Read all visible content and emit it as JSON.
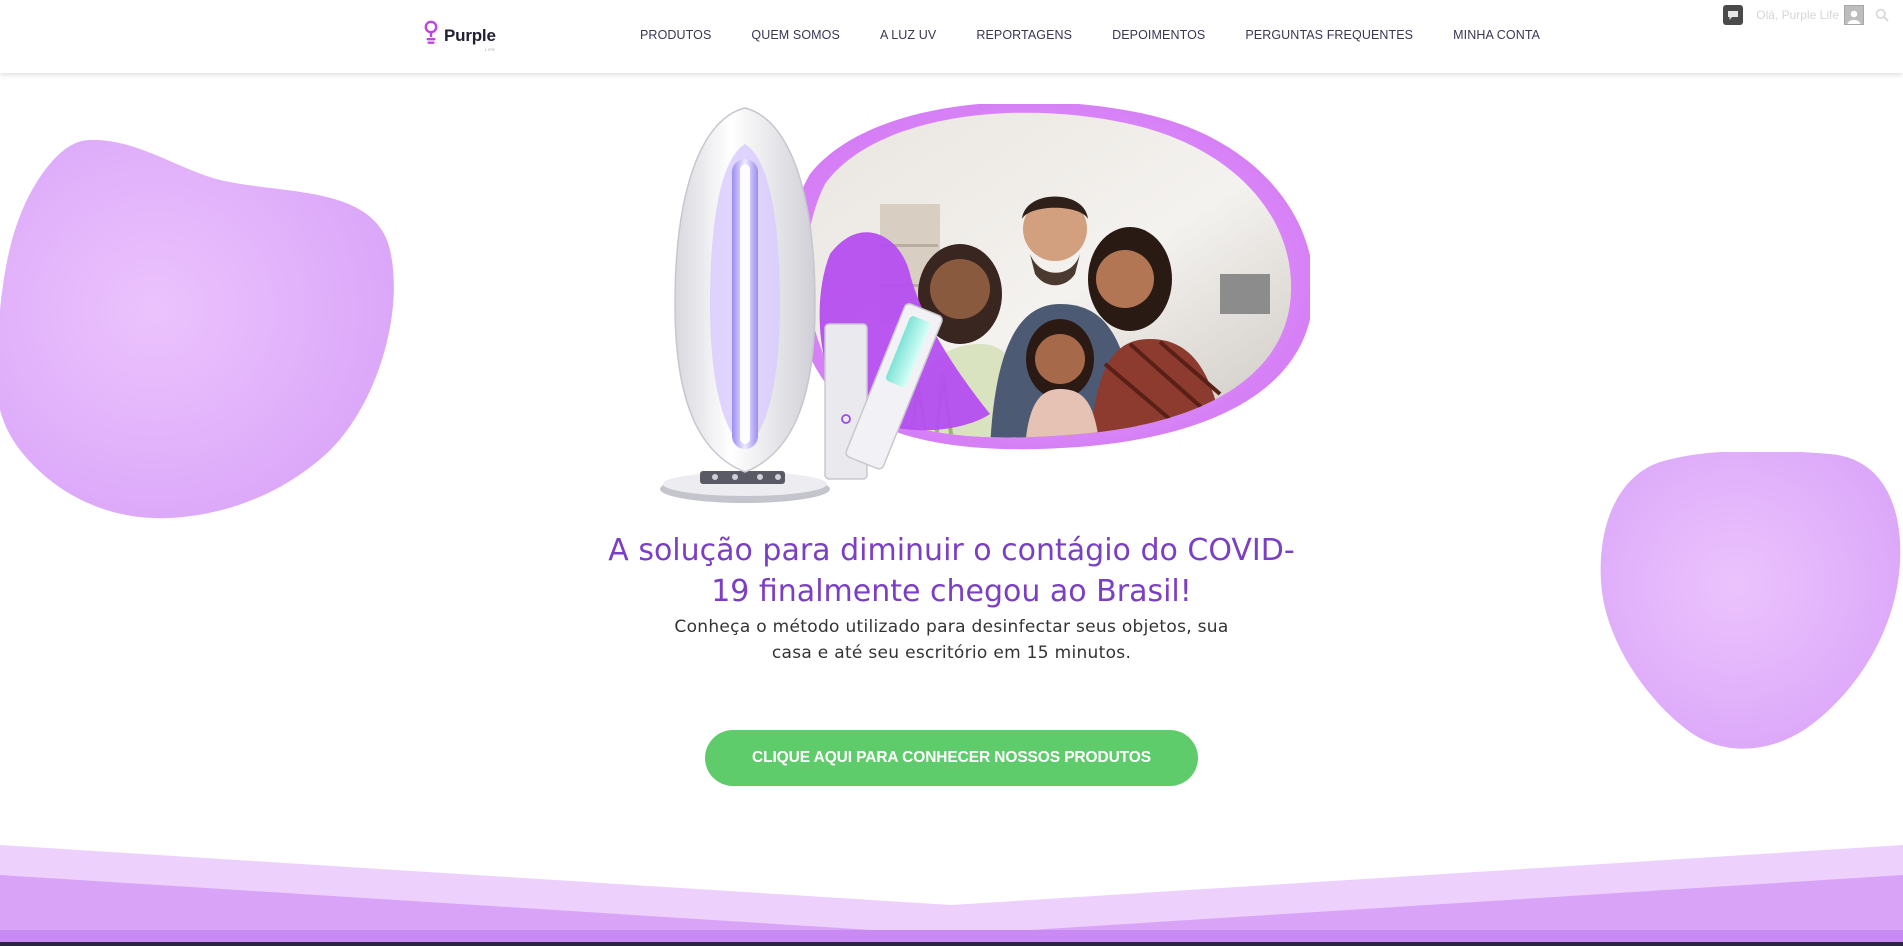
{
  "header": {
    "logo_text": "Purple",
    "logo_subtext": "LIFE",
    "nav": [
      {
        "label": "PRODUTOS"
      },
      {
        "label": "QUEM SOMOS"
      },
      {
        "label": "A LUZ UV"
      },
      {
        "label": "REPORTAGENS"
      },
      {
        "label": "DEPOIMENTOS"
      },
      {
        "label": "PERGUNTAS FREQUENTES"
      },
      {
        "label": "MINHA CONTA"
      }
    ],
    "user_greeting": "Olá, Purple Life",
    "icons": [
      "chat-icon",
      "avatar",
      "search-icon"
    ]
  },
  "hero": {
    "headline": "A solução para diminuir o contágio do COVID-19 finalmente chegou ao Brasil!",
    "subheadline": "Conheça o método utilizado para desinfectar seus objetos, sua casa e até seu escritório em 15 minutos.",
    "cta_label": "CLIQUE AQUI PARA CONHECER NOSSOS PRODUTOS",
    "image_description_icons": [
      "uv-lamp-image",
      "family-photo"
    ]
  },
  "colors": {
    "brand_purple": "#7b3fc4",
    "blob_lavender": "#e3b0fb",
    "cta_green": "#5ecc6a",
    "nav_text": "#3a3654"
  }
}
